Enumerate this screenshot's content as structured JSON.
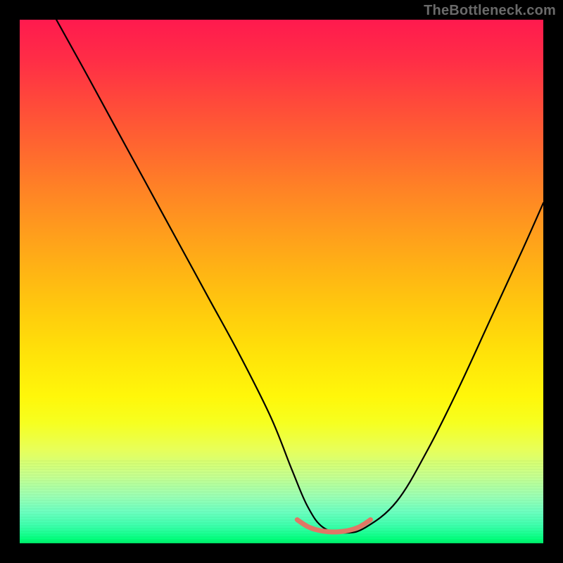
{
  "watermark": "TheBottleneck.com",
  "chart_data": {
    "type": "line",
    "title": "",
    "xlabel": "",
    "ylabel": "",
    "xlim": [
      0,
      100
    ],
    "ylim": [
      0,
      100
    ],
    "grid": false,
    "legend": null,
    "series": [
      {
        "name": "main-curve",
        "color": "#000000",
        "x": [
          7,
          12,
          18,
          24,
          30,
          36,
          42,
          48,
          52,
          55,
          58,
          62,
          66,
          72,
          78,
          84,
          90,
          96,
          100
        ],
        "y": [
          100,
          91,
          80,
          69,
          58,
          47,
          36,
          24,
          14,
          7,
          3,
          2,
          3,
          8,
          18,
          30,
          43,
          56,
          65
        ]
      },
      {
        "name": "flat-highlight",
        "color": "#E07766",
        "x": [
          53,
          55,
          57,
          59,
          61,
          63,
          65,
          67
        ],
        "y": [
          4.5,
          3.2,
          2.5,
          2.2,
          2.2,
          2.5,
          3.2,
          4.5
        ]
      }
    ],
    "background_gradient_stops": [
      {
        "pos": 0,
        "color": "#FF1A4E"
      },
      {
        "pos": 24,
        "color": "#FF6530"
      },
      {
        "pos": 48,
        "color": "#FFB414"
      },
      {
        "pos": 72,
        "color": "#FFF70A"
      },
      {
        "pos": 88,
        "color": "#B0FFA0"
      },
      {
        "pos": 100,
        "color": "#00E868"
      }
    ]
  }
}
